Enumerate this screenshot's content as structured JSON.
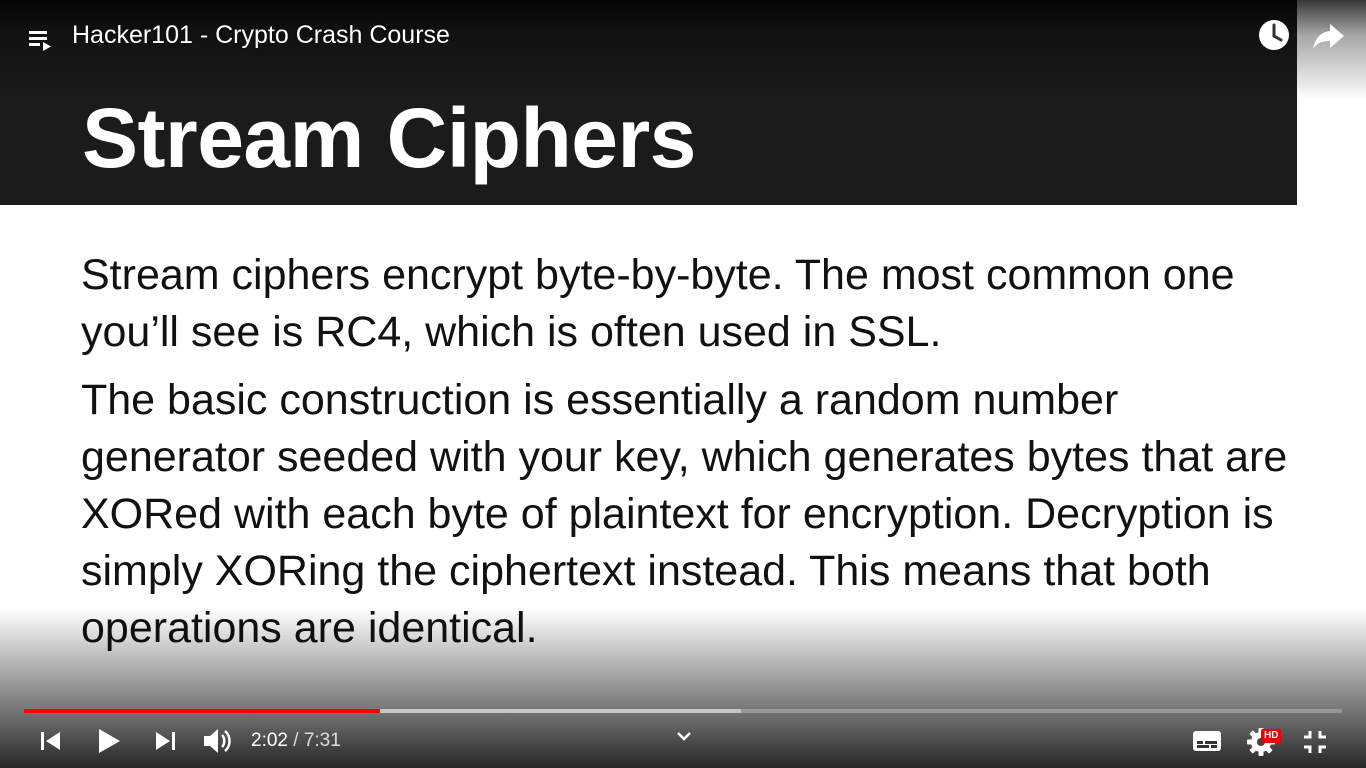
{
  "player": {
    "title": "Hacker101 - Crypto Crash Course",
    "current_time": "2:02",
    "duration": "7:31",
    "time_separator": " / ",
    "progress_played_fraction": 0.27,
    "progress_buffered_fraction": 0.544,
    "hd_badge": "HD",
    "accent_color": "#ff0000"
  },
  "slide": {
    "title": "Stream Ciphers",
    "paragraphs": [
      "Stream ciphers encrypt byte-by-byte.  The most common one you’ll see is RC4, which is often used in SSL.",
      "The basic construction is essentially a random number generator seeded with your key, which generates bytes that are XORed with each byte of plaintext for encryption. Decryption is simply XORing the ciphertext instead.  This means that both operations are identical."
    ]
  },
  "icons": {
    "playlist": "playlist-icon",
    "watch_later": "clock-icon",
    "share": "share-arrow-icon",
    "prev": "skip-previous-icon",
    "play": "play-icon",
    "next": "skip-next-icon",
    "volume": "volume-icon",
    "chevron": "chevron-down-icon",
    "captions": "subtitles-icon",
    "settings": "gear-icon",
    "fullscreen": "exit-fullscreen-icon"
  }
}
